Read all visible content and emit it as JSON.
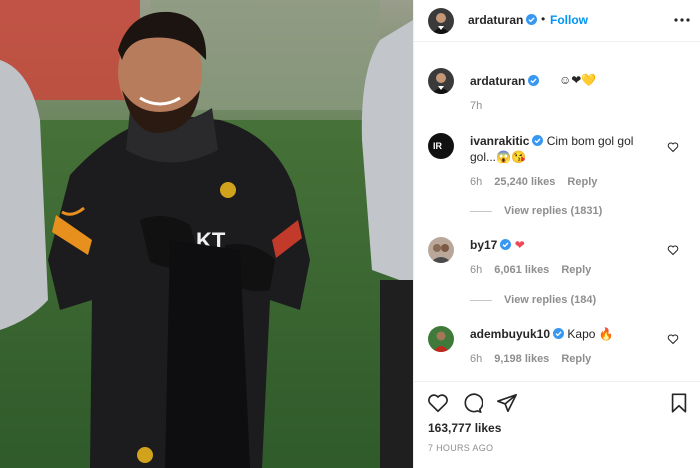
{
  "post": {
    "author": "ardaturan",
    "follow_label": "Follow",
    "caption": "☺❤💛",
    "caption_time": "7h",
    "likes": "163,777 likes",
    "time_ago": "7 HOURS AGO"
  },
  "comments": [
    {
      "user": "ivanrakitic",
      "avatar_text": "IR",
      "text": "Cim bom gol gol gol...😱😘",
      "time": "6h",
      "likes": "25,240 likes",
      "reply": "Reply",
      "view_replies": "View replies (1831)"
    },
    {
      "user": "by17",
      "text": "❤",
      "time": "6h",
      "likes": "6,061 likes",
      "reply": "Reply",
      "view_replies": "View replies (184)"
    },
    {
      "user": "adembuyuk10",
      "text": "Kapo 🔥",
      "time": "6h",
      "likes": "9,198 likes",
      "reply": "Reply"
    }
  ],
  "colors": {
    "link_blue": "#0095f6",
    "verified_blue": "#3897f0",
    "heart_red": "#ed4956"
  },
  "icons": [
    "more-options-icon",
    "verified-icon",
    "heart-icon",
    "comment-icon",
    "share-icon",
    "bookmark-icon"
  ]
}
